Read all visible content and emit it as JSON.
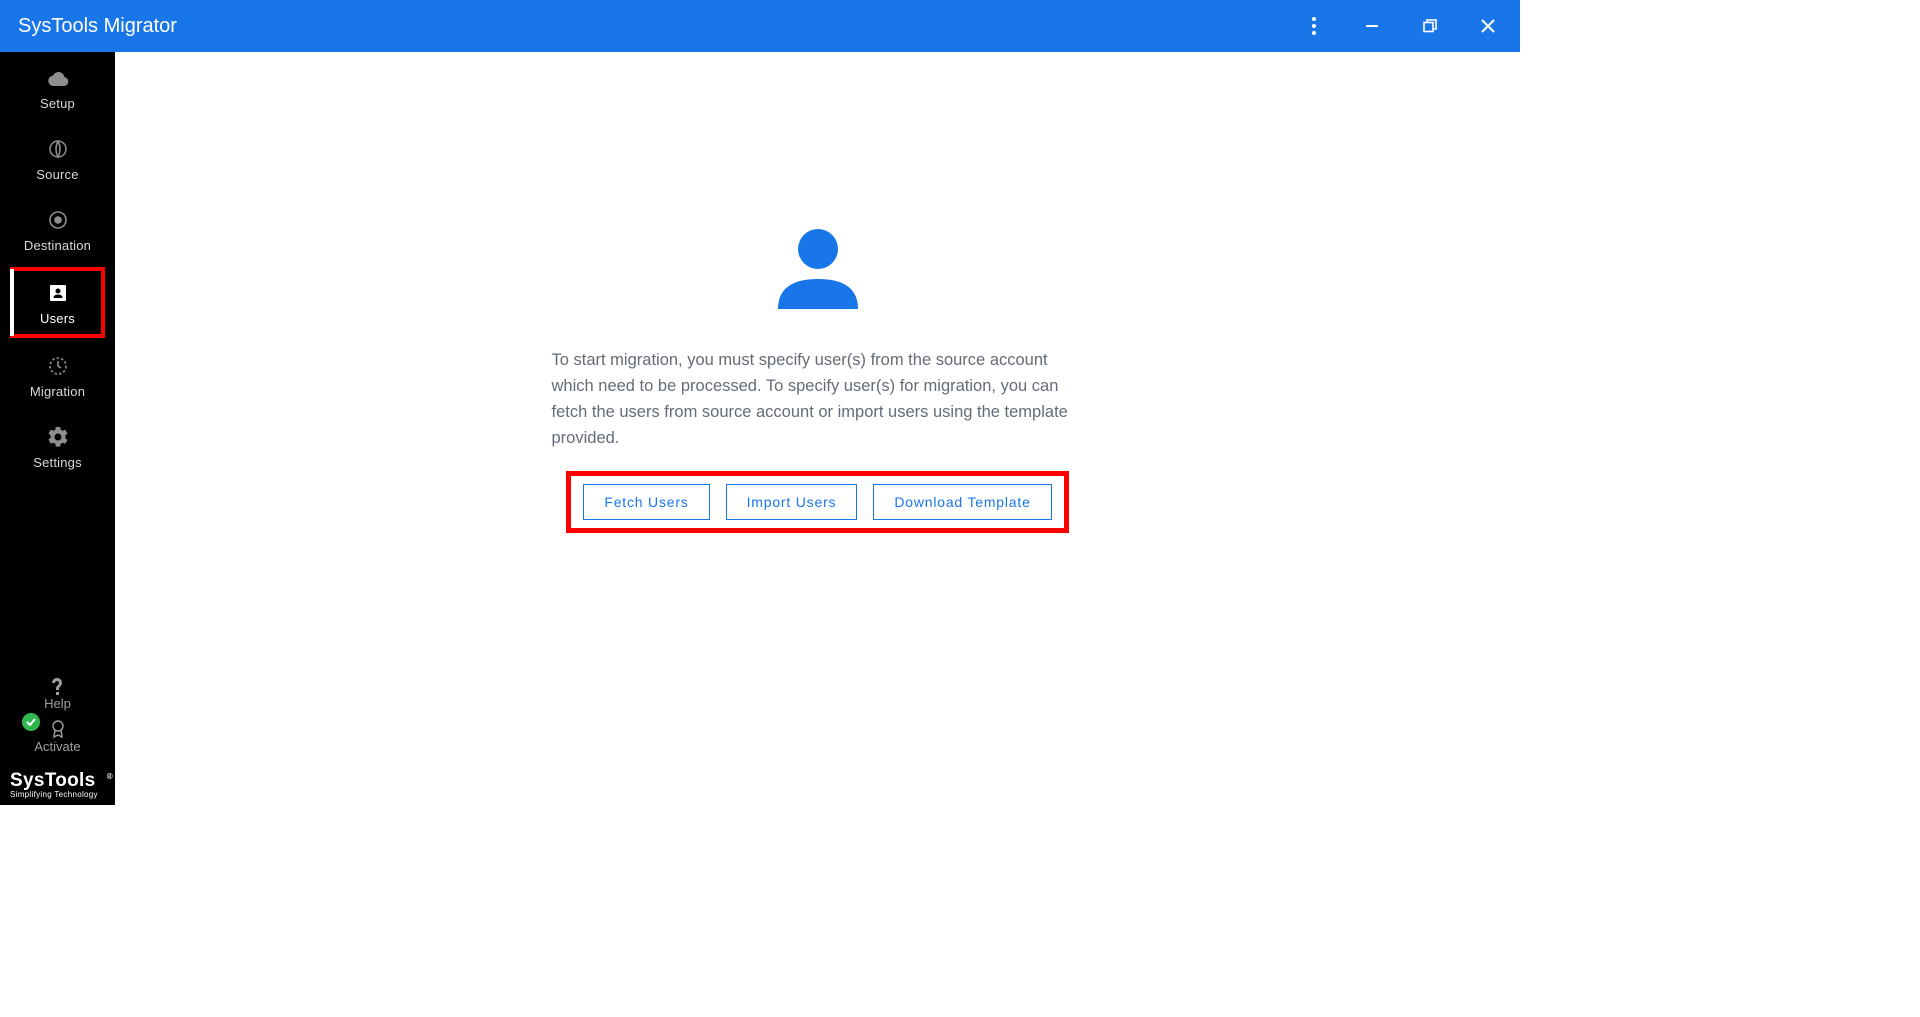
{
  "titlebar": {
    "title": "SysTools Migrator"
  },
  "sidebar": {
    "items": [
      {
        "label": "Setup"
      },
      {
        "label": "Source"
      },
      {
        "label": "Destination"
      },
      {
        "label": "Users"
      },
      {
        "label": "Migration"
      },
      {
        "label": "Settings"
      }
    ],
    "help_label": "Help",
    "activate_label": "Activate",
    "logo_main": "SysTools",
    "logo_reg": "®",
    "logo_sub": "Simplifying Technology"
  },
  "main": {
    "description": "To start migration, you must specify user(s) from the source account which need to be processed. To specify user(s) for migration, you can fetch the users from source account or import users using the template provided.",
    "fetch_users_label": "Fetch Users",
    "import_users_label": "Import Users",
    "download_template_label": "Download Template"
  },
  "colors": {
    "primary": "#1976e8",
    "highlight": "#ff0000",
    "sidebar_bg": "#000000"
  }
}
